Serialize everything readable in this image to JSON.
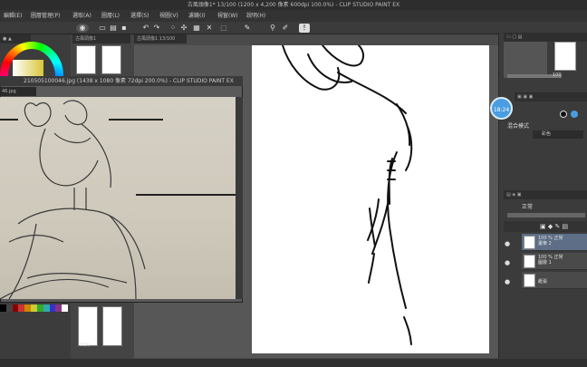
{
  "window": {
    "title": "古風頭像1* 13/100 (1200 x 4,200 像素 600dpi 100.0%) - CLIP STUDIO PAINT EX"
  },
  "menu": [
    "編輯(E)",
    "圖層管理(P)",
    "選取(A)",
    "圖層(L)",
    "選擇(S)",
    "視圖(V)",
    "濾鏡(I)",
    "視窗(W)",
    "說明(H)"
  ],
  "toolbar": {
    "icons": [
      "menu-icon",
      "new-icon",
      "open-icon",
      "save-icon",
      "undo-icon",
      "redo-icon",
      "select-icon",
      "transform-icon",
      "grid-icon",
      "ruler-icon",
      "brush-icon",
      "info-icon"
    ]
  },
  "document_tabs": {
    "tab1": "古風頭像1",
    "tab2": "古風頭像1 13/100"
  },
  "reference_window": {
    "title": "CLIP STUDIO PAINT EX",
    "title_left": "210505100046.jpg (1438 x 1080 像素 72dpi 200.0%) -",
    "tab": "46.jpg",
    "page_label": "13/e"
  },
  "right_panel": {
    "clock": "18:24",
    "blend_label": "混合模式",
    "color_label": "彩色",
    "layer_mode": "正常",
    "opacity_value": "100",
    "layers": [
      {
        "top": "100 % 正常",
        "bottom": "畫筆 2"
      },
      {
        "top": "100 % 正常",
        "bottom": "圖層 1"
      },
      {
        "top": "",
        "bottom": "紙張"
      }
    ]
  },
  "colors": {
    "accent": "#4a9de0",
    "selected_layer": "#5d6e86",
    "panel_bg": "#3b3b3b"
  }
}
